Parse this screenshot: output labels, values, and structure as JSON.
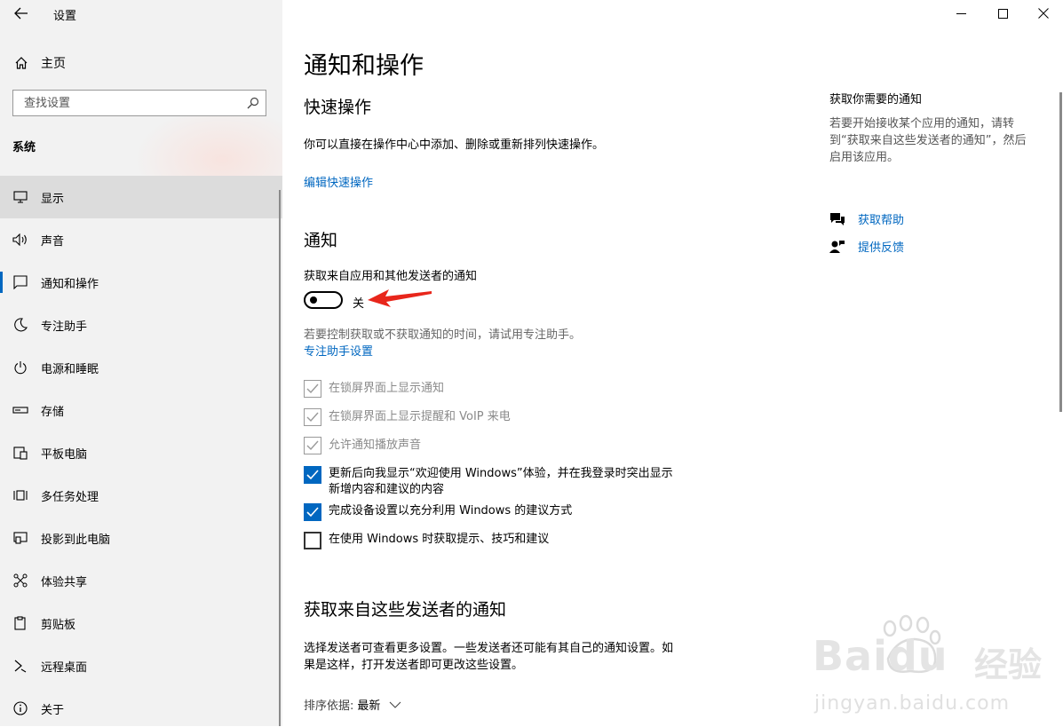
{
  "window": {
    "title": "设置",
    "minimize_icon": "minimize-icon",
    "maximize_icon": "maximize-icon",
    "close_icon": "close-icon"
  },
  "sidebar": {
    "home_label": "主页",
    "search_placeholder": "查找设置",
    "section": "系统",
    "items": [
      {
        "label": "显示",
        "icon": "monitor-icon",
        "active": true
      },
      {
        "label": "声音",
        "icon": "speaker-icon"
      },
      {
        "label": "通知和操作",
        "icon": "notification-icon",
        "selected": true
      },
      {
        "label": "专注助手",
        "icon": "moon-icon"
      },
      {
        "label": "电源和睡眠",
        "icon": "power-icon"
      },
      {
        "label": "存储",
        "icon": "storage-icon"
      },
      {
        "label": "平板电脑",
        "icon": "tablet-icon"
      },
      {
        "label": "多任务处理",
        "icon": "multitask-icon"
      },
      {
        "label": "投影到此电脑",
        "icon": "project-icon"
      },
      {
        "label": "体验共享",
        "icon": "share-icon"
      },
      {
        "label": "剪贴板",
        "icon": "clipboard-icon"
      },
      {
        "label": "远程桌面",
        "icon": "remote-desktop-icon"
      },
      {
        "label": "关于",
        "icon": "info-icon"
      }
    ]
  },
  "main": {
    "title": "通知和操作",
    "quick_actions": {
      "heading": "快速操作",
      "description": "你可以直接在操作中心中添加、删除或重新排列快速操作。",
      "edit_link": "编辑快速操作"
    },
    "notifications": {
      "heading": "通知",
      "toggle_label": "获取来自应用和其他发送者的通知",
      "toggle_state": "关",
      "toggle_on": false,
      "focus_hint": "若要控制获取或不获取通知的时间，请试用专注助手。",
      "focus_link": "专注助手设置",
      "checkboxes": [
        {
          "label": "在锁屏界面上显示通知",
          "checked": true,
          "disabled": true
        },
        {
          "label": "在锁屏界面上显示提醒和 VoIP 来电",
          "checked": true,
          "disabled": true
        },
        {
          "label": "允许通知播放声音",
          "checked": true,
          "disabled": true
        },
        {
          "label": "更新后向我显示“欢迎使用 Windows”体验，并在我登录时突出显示",
          "label2": "新增内容和建议的内容",
          "checked": true,
          "disabled": false
        },
        {
          "label": "完成设备设置以充分利用 Windows 的建议方式",
          "checked": true,
          "disabled": false
        },
        {
          "label": "在使用 Windows 时获取提示、技巧和建议",
          "checked": false,
          "disabled": false
        }
      ]
    },
    "senders": {
      "heading": "获取来自这些发送者的通知",
      "description_1": "选择发送者可查看更多设置。一些发送者还可能有其自己的通知设置。如",
      "description_2": "果是这样，打开发送者即可更改这些设置。",
      "sort_label": "排序依据:",
      "sort_value": "最新"
    }
  },
  "right_panel": {
    "heading": "获取你需要的通知",
    "text_1": "若要开始接收某个应用的通知，请转",
    "text_2": "到“获取来自这些发送者的通知”，然后",
    "text_3": "启用该应用。",
    "help_link": "获取帮助",
    "feedback_link": "提供反馈"
  },
  "watermark": {
    "brand": "Baidu",
    "brand_cn": "经验",
    "url": "jingyan.baidu.com"
  },
  "colors": {
    "accent": "#0067c0",
    "sidebar_bg": "#f2f2f2",
    "arrow": "#e8261b"
  }
}
